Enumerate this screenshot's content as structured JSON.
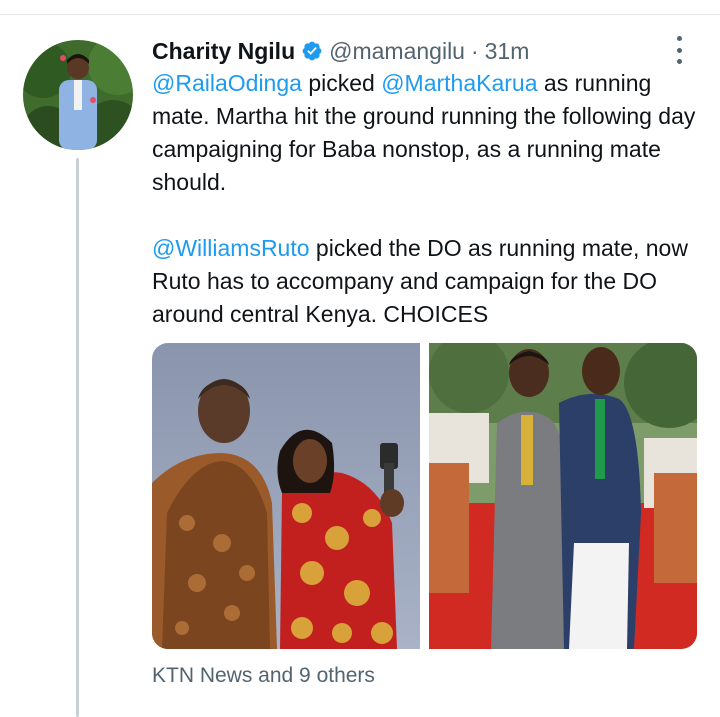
{
  "tweet": {
    "display_name": "Charity Ngilu",
    "handle": "@mamangilu",
    "separator": "·",
    "time": "31m",
    "paragraph1": {
      "mention1": "@RailaOdinga",
      "text1": " picked ",
      "mention2": "@MarthaKarua",
      "text2": " as running mate. Martha hit the ground running the following day campaigning for Baba nonstop, as a running mate should."
    },
    "paragraph2": {
      "mention1": "@WilliamsRuto",
      "text1": " picked the DO as running mate, now Ruto has to accompany and campaign for the DO around central Kenya. CHOICES"
    },
    "social_context": "KTN News and 9 others"
  },
  "colors": {
    "mention": "#1d9bf0",
    "secondary_text": "#536471",
    "verified_badge": "#1d9bf0",
    "thread_line": "#c9d1d8"
  },
  "icons": {
    "verified": "verified-badge-icon",
    "more": "more-options-icon"
  }
}
